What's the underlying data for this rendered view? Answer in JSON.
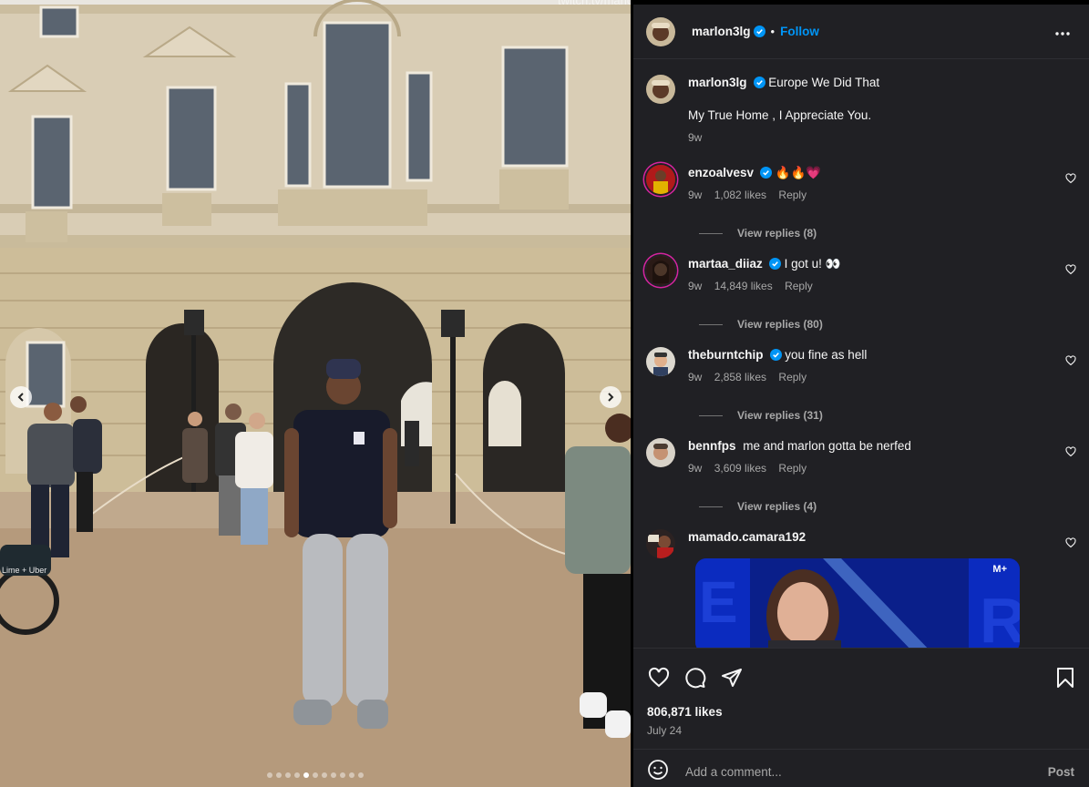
{
  "photo": {
    "watermark": "twitch.tv/marlon",
    "carousel_dots": 11,
    "active_dot": 4,
    "prev_icon": "chevron-left-icon",
    "next_icon": "chevron-right-icon"
  },
  "post_header": {
    "username": "marlon3lg",
    "separator": "•",
    "follow_label": "Follow",
    "more_icon": "more-horizontal-icon"
  },
  "caption": {
    "username": "marlon3lg",
    "text_line1": "Europe We Did That",
    "text_line2": "My True Home , I Appreciate You.",
    "time": "9w"
  },
  "comments": [
    {
      "username": "enzoalvesv",
      "text": "🔥🔥💗",
      "time": "9w",
      "likes": "1,082 likes",
      "reply": "Reply",
      "view_replies": "View replies (8)"
    },
    {
      "username": "martaa_diiaz",
      "text": "I got u! 👀",
      "time": "9w",
      "likes": "14,849 likes",
      "reply": "Reply",
      "view_replies": "View replies (80)"
    },
    {
      "username": "theburntchip",
      "text": "you fine as hell",
      "time": "9w",
      "likes": "2,858 likes",
      "reply": "Reply",
      "view_replies": "View replies (31)"
    },
    {
      "username": "bennfps",
      "text": "me and marlon gotta be nerfed",
      "time": "9w",
      "likes": "3,609 likes",
      "reply": "Reply",
      "view_replies": "View replies (4)"
    },
    {
      "username": "mamado.camara192",
      "text": "",
      "gif_badge": "M+"
    }
  ],
  "actions": {
    "likes": "806,871 likes",
    "date": "July 24",
    "comment_placeholder": "Add a comment...",
    "post_label": "Post"
  },
  "colors": {
    "panel_bg": "#202024",
    "link_blue": "#0095f6",
    "muted": "#a8a8a8",
    "verified": "#0095f6"
  }
}
